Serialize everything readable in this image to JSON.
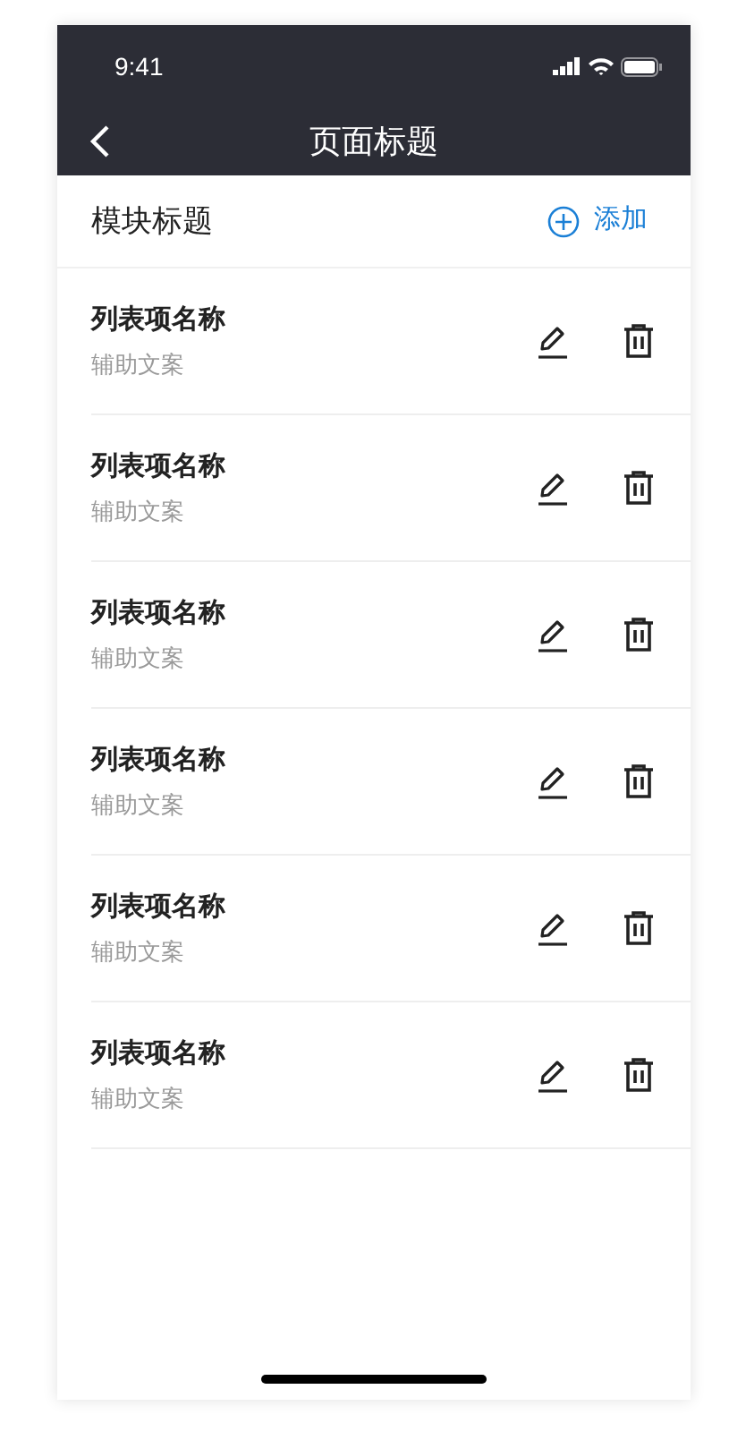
{
  "status_bar": {
    "time": "9:41"
  },
  "nav_bar": {
    "title": "页面标题"
  },
  "section": {
    "title": "模块标题",
    "add_label": "添加"
  },
  "items": [
    {
      "title": "列表项名称",
      "subtitle": "辅助文案"
    },
    {
      "title": "列表项名称",
      "subtitle": "辅助文案"
    },
    {
      "title": "列表项名称",
      "subtitle": "辅助文案"
    },
    {
      "title": "列表项名称",
      "subtitle": "辅助文案"
    },
    {
      "title": "列表项名称",
      "subtitle": "辅助文案"
    },
    {
      "title": "列表项名称",
      "subtitle": "辅助文案"
    }
  ]
}
